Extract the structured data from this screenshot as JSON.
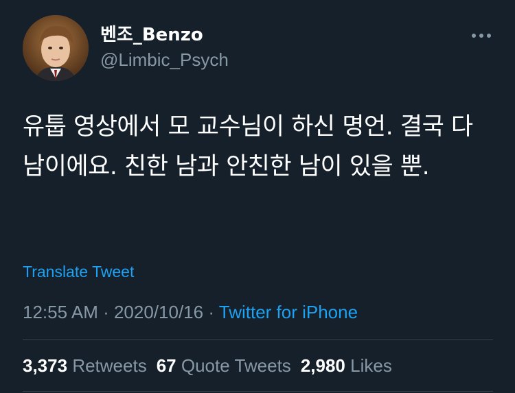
{
  "tweet": {
    "author": {
      "display_name": "벤조_Benzo",
      "handle": "@Limbic_Psych"
    },
    "text": "유툽 영상에서 모 교수님이 하신 명언. 결국 다 남이에요. 친한 남과 안친한 남이 있을 뿐.",
    "translate_label": "Translate Tweet",
    "time": "12:55 AM",
    "date": "2020/10/16",
    "separator": " · ",
    "source": "Twitter for iPhone",
    "stats": {
      "retweets_count": "3,373",
      "retweets_label": "Retweets",
      "quote_count": "67",
      "quote_label": "Quote Tweets",
      "likes_count": "2,980",
      "likes_label": "Likes"
    }
  },
  "icons": {
    "more": "more-horizontal-icon"
  },
  "colors": {
    "background": "#15202b",
    "primary_text": "#ffffff",
    "secondary_text": "#8899a6",
    "accent": "#1da1f2",
    "divider": "#38444d"
  }
}
